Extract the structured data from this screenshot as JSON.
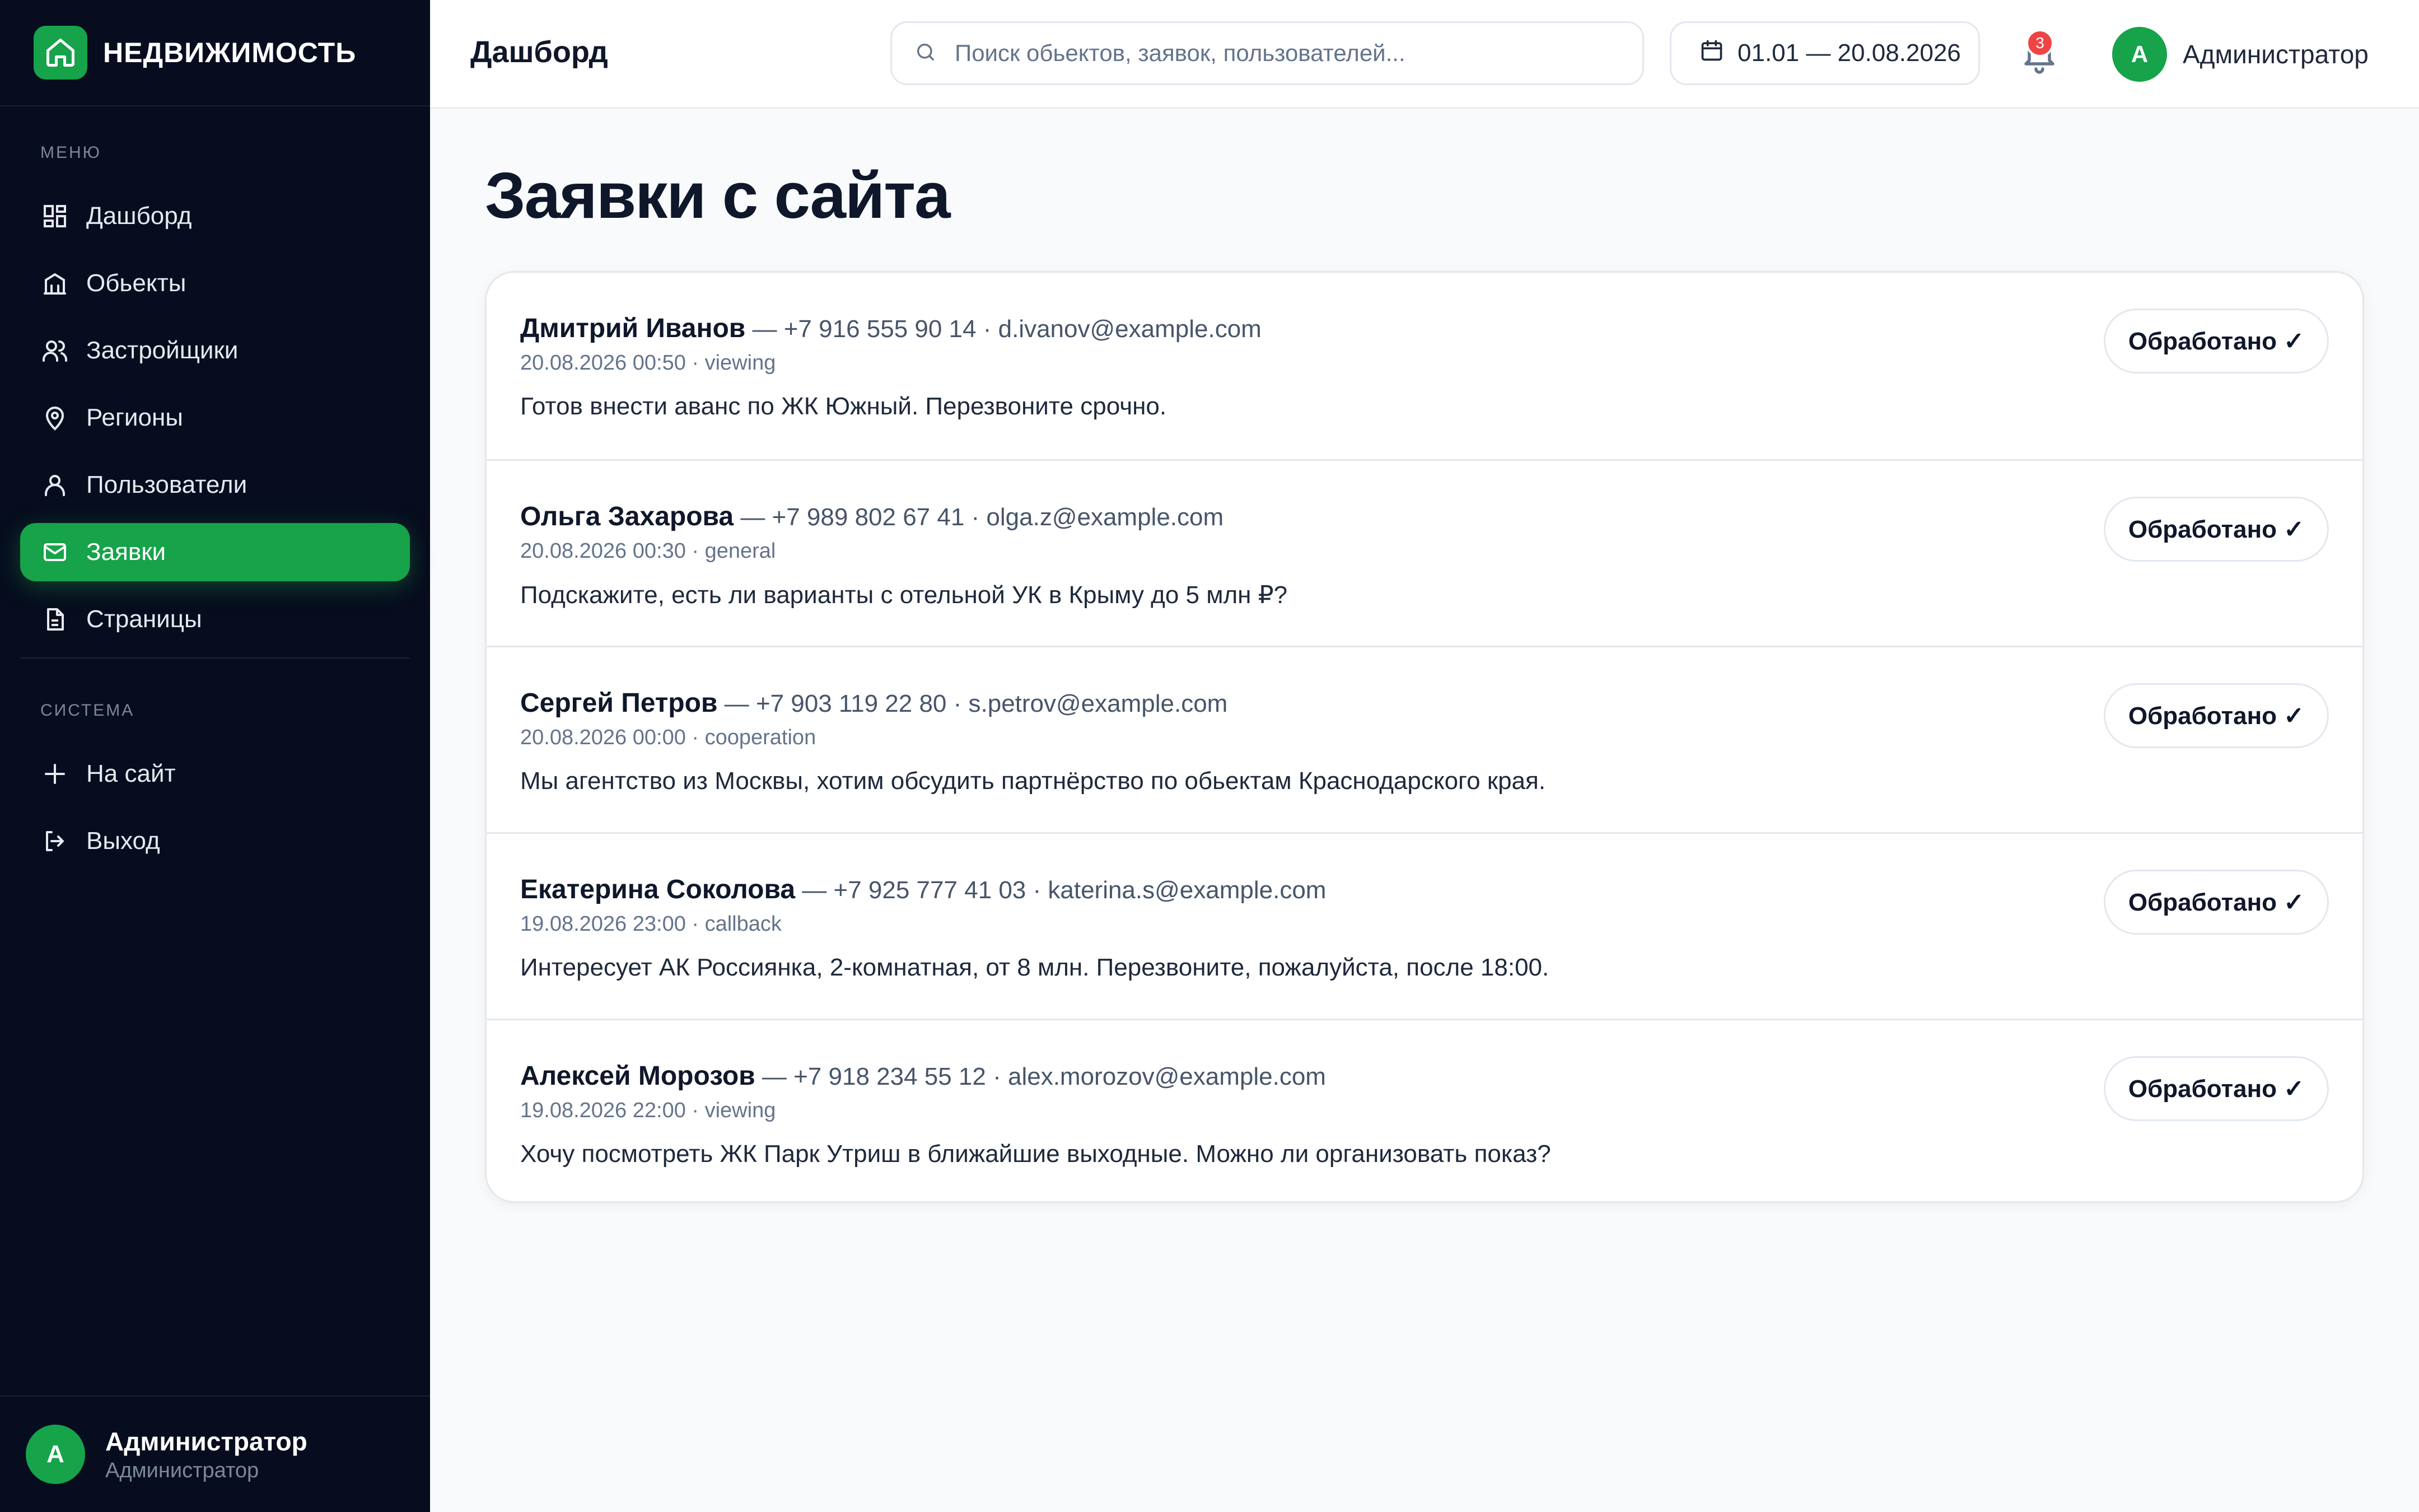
{
  "brand": {
    "name": "НЕДВИЖИМОСТЬ"
  },
  "sidebar": {
    "menu_label": "МЕНЮ",
    "system_label": "СИСТЕМА",
    "menu_items": [
      {
        "label": "Дашборд",
        "icon": "dashboard-icon"
      },
      {
        "label": "Обьекты",
        "icon": "building-icon"
      },
      {
        "label": "Застройщики",
        "icon": "users-icon"
      },
      {
        "label": "Регионы",
        "icon": "map-pin-icon"
      },
      {
        "label": "Пользователи",
        "icon": "user-icon"
      },
      {
        "label": "Заявки",
        "icon": "mail-icon",
        "active": true
      },
      {
        "label": "Страницы",
        "icon": "file-icon"
      }
    ],
    "system_items": [
      {
        "label": "На сайт",
        "icon": "plus-icon"
      },
      {
        "label": "Выход",
        "icon": "logout-icon"
      }
    ],
    "user": {
      "initial": "А",
      "name": "Администратор",
      "role": "Администратор"
    }
  },
  "header": {
    "title": "Дашборд",
    "search_placeholder": "Поиск обьектов, заявок, пользователей...",
    "date_range": "01.01 — 20.08.2026",
    "notifications_count": "3",
    "user": {
      "initial": "А",
      "name": "Администратор"
    }
  },
  "main": {
    "title": "Заявки с сайта",
    "done_label": "Обработано ✓",
    "requests": [
      {
        "name": "Дмитрий Иванов",
        "contact": " — +7 916 555 90 14 · d.ivanov@example.com",
        "meta": "20.08.2026 00:50 · viewing",
        "message": "Готов внести аванс по ЖК Южный. Перезвоните срочно."
      },
      {
        "name": "Ольга Захарова",
        "contact": " — +7 989 802 67 41 · olga.z@example.com",
        "meta": "20.08.2026 00:30 · general",
        "message": "Подскажите, есть ли варианты с отельной УК в Крыму до 5 млн ₽?"
      },
      {
        "name": "Сергей Петров",
        "contact": " — +7 903 119 22 80 · s.petrov@example.com",
        "meta": "20.08.2026 00:00 · cooperation",
        "message": "Мы агентство из Москвы, хотим обсудить партнёрство по обьектам Краснодарского края."
      },
      {
        "name": "Екатерина Соколова",
        "contact": " — +7 925 777 41 03 · katerina.s@example.com",
        "meta": "19.08.2026 23:00 · callback",
        "message": "Интересует АК Россиянка, 2-комнатная, от 8 млн. Перезвоните, пожалуйста, после 18:00."
      },
      {
        "name": "Алексей Морозов",
        "contact": " — +7 918 234 55 12 · alex.morozov@example.com",
        "meta": "19.08.2026 22:00 · viewing",
        "message": "Хочу посмотреть ЖК Парк Утриш в ближайшие выходные. Можно ли организовать показ?"
      }
    ]
  },
  "colors": {
    "accent": "#16a34a",
    "sidebar_bg": "#070d1e",
    "badge": "#ef4444"
  }
}
